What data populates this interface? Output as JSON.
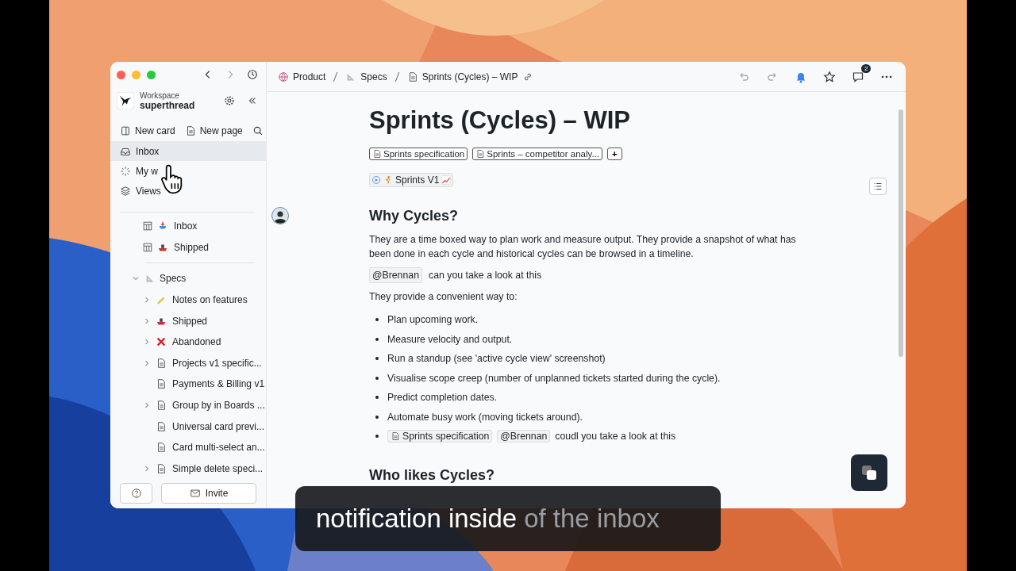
{
  "sidebar": {
    "workspace_label": "Workspace",
    "workspace_name": "superthread",
    "actions": [
      {
        "label": "New card",
        "kind": "card"
      },
      {
        "label": "New page",
        "kind": "page"
      }
    ],
    "nav": [
      {
        "label": "Inbox",
        "kind": "inbox",
        "selected": true
      },
      {
        "label": "My w",
        "kind": "work",
        "selected": false
      },
      {
        "label": "Views",
        "kind": "views",
        "selected": false
      }
    ],
    "boards": [
      {
        "label": "Inbox",
        "kind": "inbox"
      },
      {
        "label": "Shipped",
        "kind": "ship"
      }
    ],
    "tree": {
      "label": "Specs",
      "expanded": true,
      "children": [
        {
          "label": "Notes on features",
          "kind": "note",
          "has_children": true
        },
        {
          "label": "Shipped",
          "kind": "ship",
          "has_children": true
        },
        {
          "label": "Abandoned",
          "kind": "cross",
          "has_children": true
        },
        {
          "label": "Projects v1 specific...",
          "kind": "doc",
          "has_children": true
        },
        {
          "label": "Payments & Billing v1",
          "kind": "doc",
          "has_children": false
        },
        {
          "label": "Group by in Boards ...",
          "kind": "doc",
          "has_children": true
        },
        {
          "label": "Universal card previ...",
          "kind": "doc",
          "has_children": false
        },
        {
          "label": "Card multi-select an...",
          "kind": "doc",
          "has_children": false
        },
        {
          "label": "Simple delete speci...",
          "kind": "doc",
          "has_children": true
        }
      ]
    },
    "invite": "Invite"
  },
  "breadcrumb": [
    {
      "label": "Product",
      "kind": "globe"
    },
    {
      "label": "Specs",
      "kind": "ruler"
    },
    {
      "label": "Sprints (Cycles) – WIP",
      "kind": "doc"
    }
  ],
  "comments_badge": "2",
  "page": {
    "title": "Sprints (Cycles) – WIP",
    "chips": [
      "Sprints specification",
      "Sprints – competitor analy..."
    ],
    "add_chip": "+",
    "linked": "Sprints V1",
    "blocks": [
      {
        "kind": "heading",
        "text": "Why Cycles?"
      },
      {
        "kind": "paragraph",
        "parts": [
          {
            "kind": "text",
            "text": "They are a time boxed way to plan work and measure output. They provide a snapshot of what has been done in each cycle and historical cycles can be browsed in a timeline."
          }
        ]
      },
      {
        "kind": "paragraph",
        "parts": [
          {
            "kind": "mention",
            "text": "@Brennan"
          },
          {
            "kind": "text",
            "text": "can you take a look at this"
          }
        ]
      },
      {
        "kind": "paragraph",
        "parts": [
          {
            "kind": "text",
            "text": "They provide a convenient way to:"
          }
        ]
      },
      {
        "kind": "bullets",
        "items": [
          [
            {
              "kind": "text",
              "text": "Plan upcoming work."
            }
          ],
          [
            {
              "kind": "text",
              "text": "Measure velocity and output."
            }
          ],
          [
            {
              "kind": "text",
              "text": "Run a standup (see 'active cycle view' screenshot)"
            }
          ],
          [
            {
              "kind": "text",
              "text": "Visualise scope creep (number of unplanned tickets started during the cycle)."
            }
          ],
          [
            {
              "kind": "text",
              "text": "Predict completion dates."
            }
          ],
          [
            {
              "kind": "text",
              "text": "Automate busy work (moving tickets around)."
            }
          ],
          [
            {
              "kind": "doc",
              "text": "Sprints specification"
            },
            {
              "kind": "mention",
              "text": "@Brennan"
            },
            {
              "kind": "text",
              "text": "coudl you take a look at this"
            }
          ]
        ]
      },
      {
        "kind": "heading",
        "text": "Who likes Cycles?"
      }
    ]
  },
  "caption": {
    "spoken": "notification inside",
    "upcoming": "of the inbox"
  }
}
